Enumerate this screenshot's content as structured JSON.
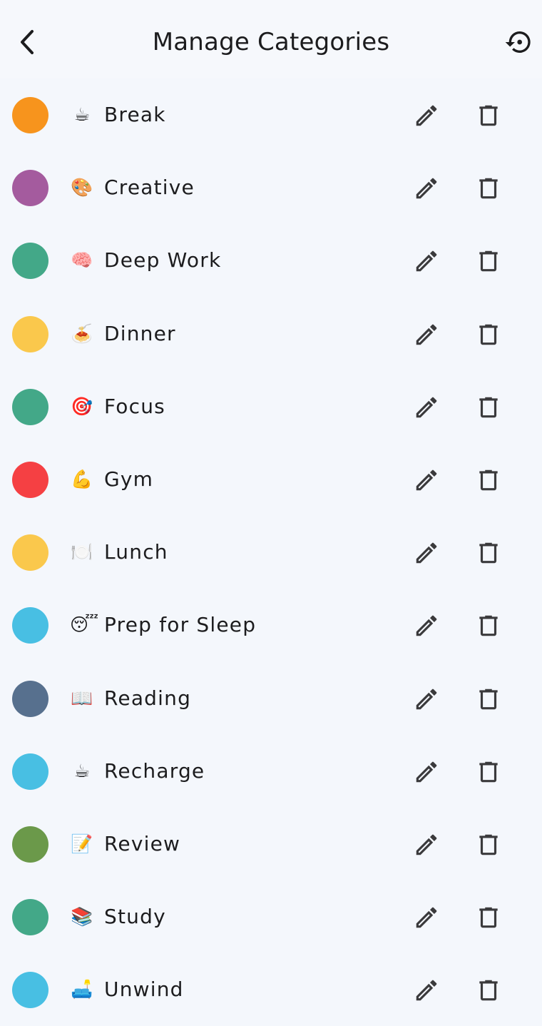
{
  "header": {
    "title": "Manage Categories",
    "back_icon": "chevron-left-icon",
    "reset_icon": "restore-icon"
  },
  "icons": {
    "edit": "pencil-icon",
    "delete": "trash-icon"
  },
  "colors": {
    "background": "#f4f7fc",
    "icon": "#3a3a3c"
  },
  "categories": [
    {
      "name": "Break",
      "emoji": "☕",
      "color": "#f7941d"
    },
    {
      "name": "Creative",
      "emoji": "🎨",
      "color": "#a45b9e"
    },
    {
      "name": "Deep Work",
      "emoji": "🧠",
      "color": "#43a888"
    },
    {
      "name": "Dinner",
      "emoji": "🍝",
      "color": "#fac84c"
    },
    {
      "name": "Focus",
      "emoji": "🎯",
      "color": "#43a888"
    },
    {
      "name": "Gym",
      "emoji": "💪",
      "color": "#f54043"
    },
    {
      "name": "Lunch",
      "emoji": "🍽️",
      "color": "#fac84c"
    },
    {
      "name": "Prep for Sleep",
      "emoji": "😴",
      "color": "#48bfe3"
    },
    {
      "name": "Reading",
      "emoji": "📖",
      "color": "#57708e"
    },
    {
      "name": "Recharge",
      "emoji": "☕",
      "color": "#48bfe3"
    },
    {
      "name": "Review",
      "emoji": "📝",
      "color": "#6b994a"
    },
    {
      "name": "Study",
      "emoji": "📚",
      "color": "#43a888"
    },
    {
      "name": "Unwind",
      "emoji": "🛋️",
      "color": "#48bfe3"
    }
  ]
}
